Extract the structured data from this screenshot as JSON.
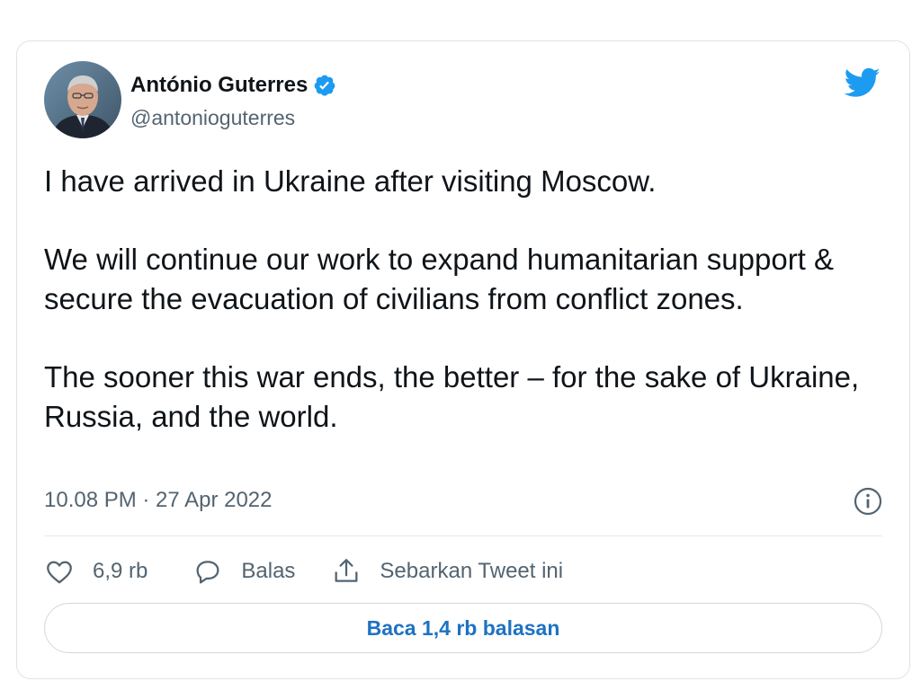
{
  "author": {
    "display_name": "António Guterres",
    "handle": "@antonioguterres",
    "verified": true
  },
  "tweet": {
    "paragraphs": [
      "I have arrived in Ukraine after visiting Moscow.",
      "We will continue our work to expand humanitarian support & secure the evacuation of civilians from conflict zones.",
      "The sooner this war ends, the better – for the sake of Ukraine, Russia, and the world."
    ],
    "timestamp": "10.08 PM · 27 Apr 2022"
  },
  "actions": {
    "like_count": "6,9 rb",
    "reply_label": "Balas",
    "share_label": "Sebarkan Tweet ini"
  },
  "read_replies_label": "Baca 1,4 rb balasan",
  "icons": {
    "brand": "twitter-bird-icon",
    "verified": "verified-badge-icon",
    "info": "info-icon",
    "like": "heart-icon",
    "reply": "speech-bubble-icon",
    "share": "share-upload-icon"
  },
  "colors": {
    "brand_blue": "#1d9bf0",
    "link_blue": "#1d72c2",
    "text_primary": "#0f1419",
    "text_secondary": "#536471"
  }
}
